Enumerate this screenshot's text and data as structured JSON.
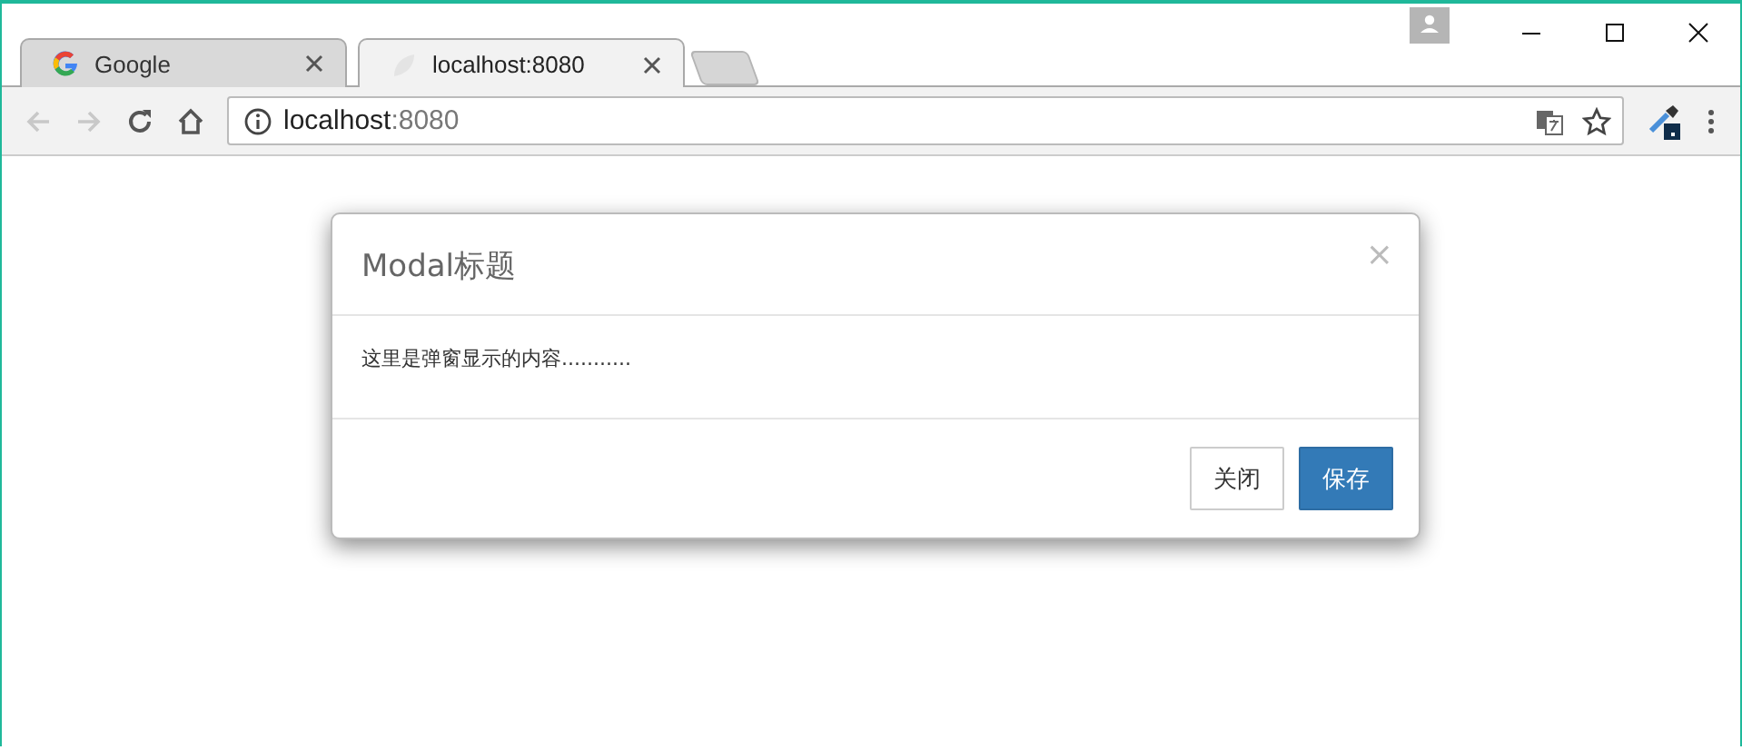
{
  "tabs": [
    {
      "kind": "google",
      "label": "Google",
      "selected": false
    },
    {
      "kind": "page",
      "label": "localhost:8080",
      "selected": true
    }
  ],
  "address_bar": {
    "host": "localhost",
    "port": ":8080"
  },
  "modal": {
    "title": "Modal标题",
    "close": "×",
    "body": "这里是弹窗显示的内容...........",
    "buttons": [
      {
        "kind": "default",
        "label": "关闭"
      },
      {
        "kind": "primary",
        "label": "保存"
      }
    ]
  }
}
